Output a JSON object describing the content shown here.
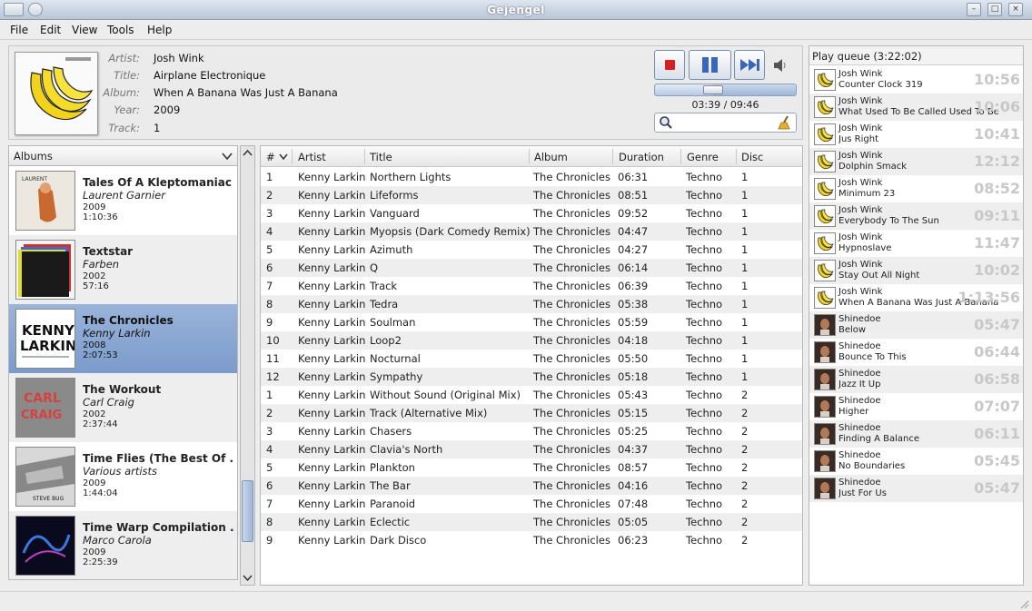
{
  "window": {
    "title": "Gejengel"
  },
  "menu": [
    "File",
    "Edit",
    "View",
    "Tools",
    "Help"
  ],
  "now_playing": {
    "labels": {
      "artist": "Artist:",
      "title": "Title:",
      "album": "Album:",
      "year": "Year:",
      "track": "Track:"
    },
    "artist": "Josh Wink",
    "title": "Airplane Electronique",
    "album": "When A Banana Was Just A Banana",
    "year": "2009",
    "track": "1",
    "elapsed_fraction": 0.4
  },
  "player": {
    "time": "03:39 / 09:46",
    "search_value": ""
  },
  "albums_dropdown": "Albums",
  "albums": [
    {
      "title": "Tales Of A Kleptomaniac",
      "artist": "Laurent Garnier",
      "year": "2009",
      "length": "1:10:36"
    },
    {
      "title": "Textstar",
      "artist": "Farben",
      "year": "2002",
      "length": "57:16"
    },
    {
      "title": "The Chronicles",
      "artist": "Kenny Larkin",
      "year": "2008",
      "length": "2:07:53",
      "selected": true
    },
    {
      "title": "The Workout",
      "artist": "Carl Craig",
      "year": "2002",
      "length": "2:37:44"
    },
    {
      "title": "Time Flies (The Best Of ...",
      "artist": "Various artists",
      "year": "2009",
      "length": "1:44:04"
    },
    {
      "title": "Time Warp Compilation ...",
      "artist": "Marco Carola",
      "year": "2009",
      "length": "2:25:39"
    }
  ],
  "track_columns": [
    "#",
    "Artist",
    "Title",
    "Album",
    "Duration",
    "Genre",
    "Disc"
  ],
  "tracks": [
    [
      "1",
      "Kenny Larkin",
      "Northern Lights",
      "The Chronicles",
      "06:31",
      "Techno",
      "1"
    ],
    [
      "2",
      "Kenny Larkin",
      "Lifeforms",
      "The Chronicles",
      "08:51",
      "Techno",
      "1"
    ],
    [
      "3",
      "Kenny Larkin",
      "Vanguard",
      "The Chronicles",
      "09:52",
      "Techno",
      "1"
    ],
    [
      "4",
      "Kenny Larkin",
      "Myopsis (Dark Comedy Remix)",
      "The Chronicles",
      "04:47",
      "Techno",
      "1"
    ],
    [
      "5",
      "Kenny Larkin",
      "Azimuth",
      "The Chronicles",
      "04:27",
      "Techno",
      "1"
    ],
    [
      "6",
      "Kenny Larkin",
      "Q",
      "The Chronicles",
      "06:14",
      "Techno",
      "1"
    ],
    [
      "7",
      "Kenny Larkin",
      "Track",
      "The Chronicles",
      "06:39",
      "Techno",
      "1"
    ],
    [
      "8",
      "Kenny Larkin",
      "Tedra",
      "The Chronicles",
      "05:38",
      "Techno",
      "1"
    ],
    [
      "9",
      "Kenny Larkin",
      "Soulman",
      "The Chronicles",
      "05:59",
      "Techno",
      "1"
    ],
    [
      "10",
      "Kenny Larkin",
      "Loop2",
      "The Chronicles",
      "04:18",
      "Techno",
      "1"
    ],
    [
      "11",
      "Kenny Larkin",
      "Nocturnal",
      "The Chronicles",
      "05:50",
      "Techno",
      "1"
    ],
    [
      "12",
      "Kenny Larkin",
      "Sympathy",
      "The Chronicles",
      "05:18",
      "Techno",
      "1"
    ],
    [
      "1",
      "Kenny Larkin",
      "Without Sound (Original Mix)",
      "The Chronicles",
      "05:43",
      "Techno",
      "2"
    ],
    [
      "2",
      "Kenny Larkin",
      "Track (Alternative Mix)",
      "The Chronicles",
      "05:15",
      "Techno",
      "2"
    ],
    [
      "3",
      "Kenny Larkin",
      "Chasers",
      "The Chronicles",
      "05:25",
      "Techno",
      "2"
    ],
    [
      "4",
      "Kenny Larkin",
      "Clavia's North",
      "The Chronicles",
      "04:37",
      "Techno",
      "2"
    ],
    [
      "5",
      "Kenny Larkin",
      "Plankton",
      "The Chronicles",
      "08:57",
      "Techno",
      "2"
    ],
    [
      "6",
      "Kenny Larkin",
      "The Bar",
      "The Chronicles",
      "04:16",
      "Techno",
      "2"
    ],
    [
      "7",
      "Kenny Larkin",
      "Paranoid",
      "The Chronicles",
      "07:48",
      "Techno",
      "2"
    ],
    [
      "8",
      "Kenny Larkin",
      "Eclectic",
      "The Chronicles",
      "05:05",
      "Techno",
      "2"
    ],
    [
      "9",
      "Kenny Larkin",
      "Dark Disco",
      "The Chronicles",
      "06:23",
      "Techno",
      "2"
    ]
  ],
  "queue": {
    "title": "Play queue (3:22:02)",
    "items": [
      {
        "artist": "Josh Wink",
        "title": "Counter Clock 319",
        "duration": "10:56",
        "cover": "banana"
      },
      {
        "artist": "Josh Wink",
        "title": "What Used To Be Called Used To Be",
        "duration": "10:06",
        "cover": "banana"
      },
      {
        "artist": "Josh Wink",
        "title": "Jus Right",
        "duration": "10:41",
        "cover": "banana"
      },
      {
        "artist": "Josh Wink",
        "title": "Dolphin Smack",
        "duration": "12:12",
        "cover": "banana"
      },
      {
        "artist": "Josh Wink",
        "title": "Minimum 23",
        "duration": "08:52",
        "cover": "banana"
      },
      {
        "artist": "Josh Wink",
        "title": "Everybody To The Sun",
        "duration": "09:11",
        "cover": "banana"
      },
      {
        "artist": "Josh Wink",
        "title": "Hypnoslave",
        "duration": "11:47",
        "cover": "banana"
      },
      {
        "artist": "Josh Wink",
        "title": "Stay Out All Night",
        "duration": "10:02",
        "cover": "banana"
      },
      {
        "artist": "Josh Wink",
        "title": "When A Banana Was Just A Banana",
        "duration": "1:13:56",
        "cover": "banana"
      },
      {
        "artist": "Shinedoe",
        "title": "Below",
        "duration": "05:47",
        "cover": "face"
      },
      {
        "artist": "Shinedoe",
        "title": "Bounce To This",
        "duration": "06:44",
        "cover": "face"
      },
      {
        "artist": "Shinedoe",
        "title": "Jazz It Up",
        "duration": "06:58",
        "cover": "face"
      },
      {
        "artist": "Shinedoe",
        "title": "Higher",
        "duration": "07:07",
        "cover": "face"
      },
      {
        "artist": "Shinedoe",
        "title": "Finding A Balance",
        "duration": "06:11",
        "cover": "face"
      },
      {
        "artist": "Shinedoe",
        "title": "No Boundaries",
        "duration": "05:45",
        "cover": "face"
      },
      {
        "artist": "Shinedoe",
        "title": "Just For Us",
        "duration": "05:47",
        "cover": "face"
      }
    ]
  },
  "colors": {
    "accent": "#86a4cf",
    "stop": "#d62020",
    "play": "#3a66b8"
  }
}
